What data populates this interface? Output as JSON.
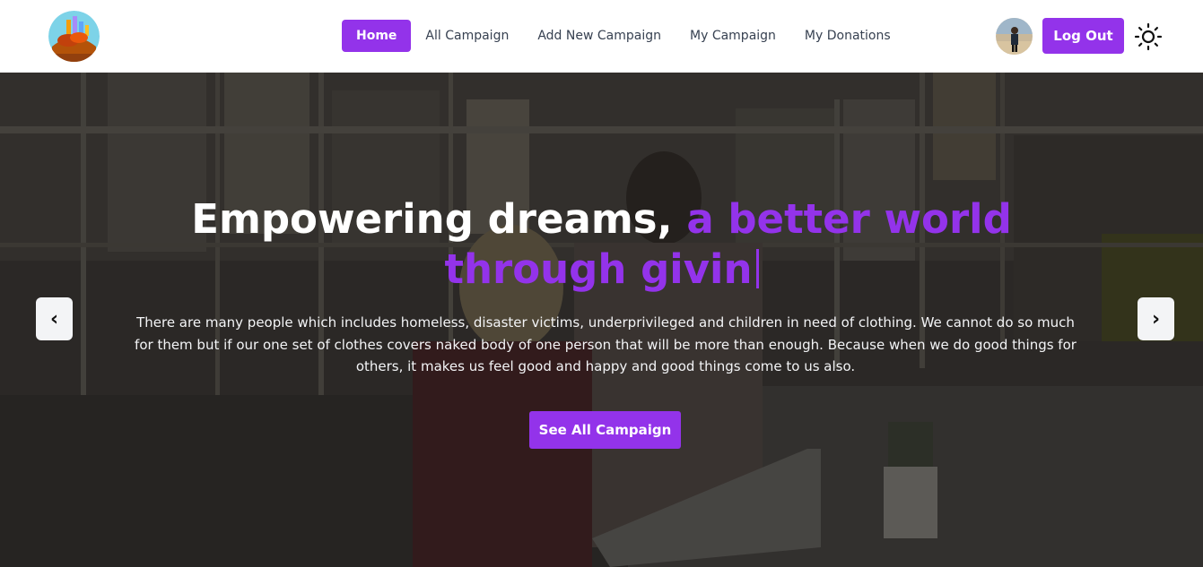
{
  "nav": {
    "items": [
      {
        "label": "Home",
        "active": true
      },
      {
        "label": "All Campaign",
        "active": false
      },
      {
        "label": "Add New Campaign",
        "active": false
      },
      {
        "label": "My Campaign",
        "active": false
      },
      {
        "label": "My Donations",
        "active": false
      }
    ],
    "logout_label": "Log Out",
    "theme_icon": "sun-icon"
  },
  "hero": {
    "title_part1": "Empowering dreams, ",
    "title_accent": "a better world through givin",
    "description": "There are many people which includes homeless, disaster victims, underprivileged and children in need of clothing. We cannot do so much for them but if our one set of clothes covers naked body of one person that will be more than enough. Because when we do good things for others, it makes us feel good and happy and good things come to us also.",
    "cta_label": "See All Campaign",
    "prev_icon": "chevron-left-icon",
    "next_icon": "chevron-right-icon",
    "prev_glyph": "‹",
    "next_glyph": "›"
  },
  "colors": {
    "accent": "#9333ea",
    "nav_text": "#374151",
    "hero_overlay": "#1f1d1b"
  }
}
